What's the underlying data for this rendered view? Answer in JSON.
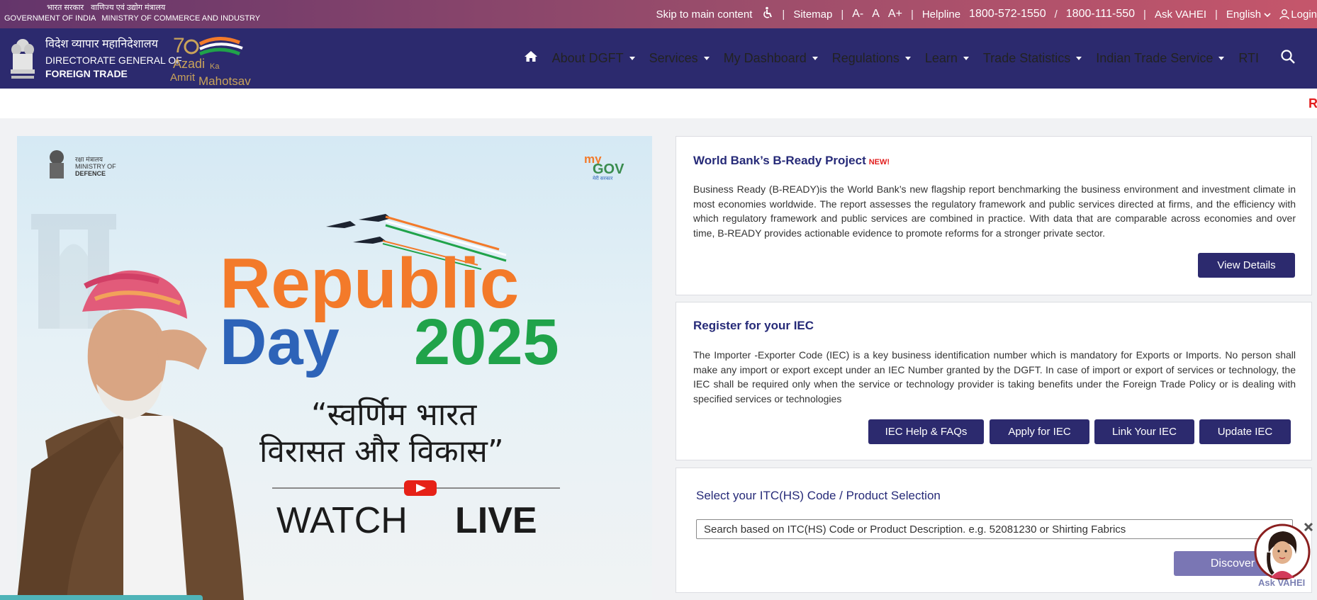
{
  "topbar": {
    "gov_hi_1": "भारत सरकार",
    "gov_hi_2": "वाणिज्य एवं उद्योग मंत्रालय",
    "gov_en_1": "GOVERNMENT OF INDIA",
    "gov_en_2": "MINISTRY OF COMMERCE AND INDUSTRY",
    "skip": "Skip to main content",
    "sitemap": "Sitemap",
    "font_small": "A-",
    "font_normal": "A",
    "font_large": "A+",
    "helpline_label": "Helpline",
    "helpline_1": "1800-572-1550",
    "helpline_2": "1800-111-550",
    "ask_vahei": "Ask VAHEI",
    "language": "English",
    "login": "Login"
  },
  "brand": {
    "hi": "विदेश व्यापार महानिदेशालय",
    "en1": "DIRECTORATE GENERAL OF",
    "en2": "FOREIGN TRADE",
    "azadi_1": "Azadi",
    "azadi_2": "Ka",
    "azadi_3": "Amrit",
    "azadi_4": "Mahotsav"
  },
  "nav": {
    "items": [
      {
        "label": "About DGFT"
      },
      {
        "label": "Services"
      },
      {
        "label": "My Dashboard"
      },
      {
        "label": "Regulations"
      },
      {
        "label": "Learn"
      },
      {
        "label": "Trade Statistics"
      },
      {
        "label": "Indian Trade Service"
      }
    ],
    "rti": "RTI"
  },
  "marquee": {
    "text": "R"
  },
  "banner": {
    "ministry_hi": "रक्षा मंत्रालय",
    "ministry_en_1": "MINISTRY OF",
    "ministry_en_2": "DEFENCE",
    "mygov_1": "my",
    "mygov_2": "GOV",
    "mygov_3": "मेरी सरकार",
    "title_1": "Republic",
    "title_2a": "Day",
    "title_2b": "2025",
    "slogan_1": "“स्वर्णिम भारत",
    "slogan_2": "विरासत और विकास”",
    "watch": "WATCH",
    "live": "LIVE"
  },
  "card1": {
    "title": "World Bank’s B-Ready Project",
    "badge": "NEW!",
    "text": "Business Ready (B-READY)is the World Bank’s new flagship report benchmarking the business environment and investment climate in most economies worldwide. The report assesses the regulatory framework and public services directed at firms, and the efficiency with which regulatory framework and public services are combined in practice. With data that are comparable across economies and over time, B-READY provides actionable evidence to promote reforms for a stronger private sector.",
    "button": "View Details"
  },
  "card2": {
    "title": "Register for your IEC",
    "text": "The Importer -Exporter Code (IEC) is a key business identification number which is mandatory for Exports or Imports. No person shall make any import or export except under an IEC Number granted by the DGFT. In case of import or export of services or technology, the IEC shall be required only when the service or technology provider is taking benefits under the Foreign Trade Policy or is dealing with specified services or technologies",
    "buttons": [
      "IEC Help & FAQs",
      "Apply for IEC",
      "Link Your IEC",
      "Update IEC"
    ]
  },
  "card3": {
    "title": "Select your ITC(HS) Code / Product Selection",
    "placeholder": "Search based on ITC(HS) Code or Product Description. e.g. 52081230 or Shirting Fabrics",
    "button": "Discover"
  },
  "vahei": {
    "label": "Ask VAHEI"
  },
  "colors": {
    "nav_bg": "#2c2a6e",
    "accent_red": "#e21e1e",
    "saffron": "#f37a2a",
    "green": "#20a34a",
    "blue": "#2d63b8"
  }
}
